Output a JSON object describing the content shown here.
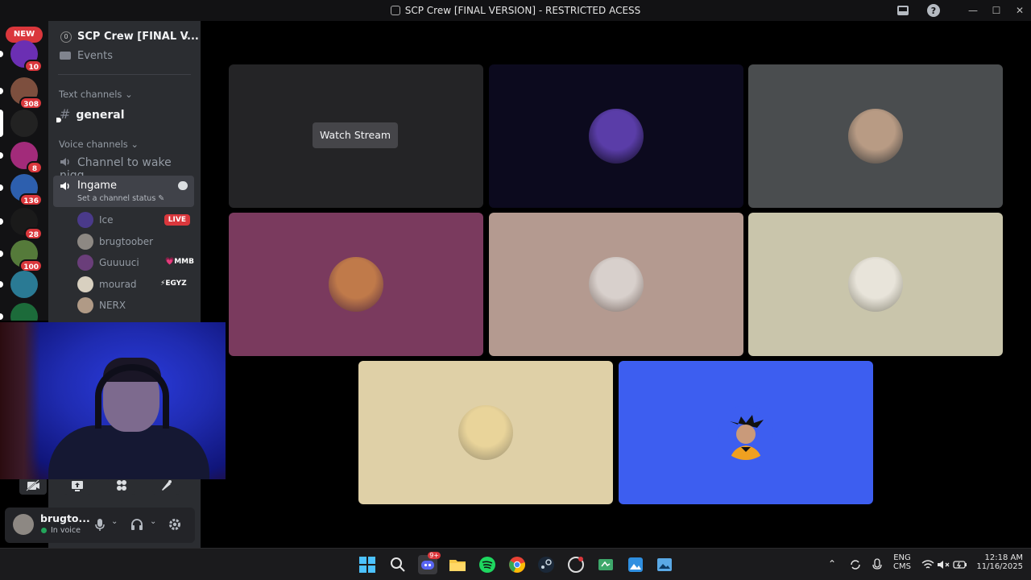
{
  "window": {
    "title": "SCP Crew [FINAL VERSION] - RESTRICTED ACESS",
    "controls": [
      "minimize",
      "maximize",
      "close"
    ]
  },
  "rail": {
    "new_badge": "NEW",
    "servers": [
      {
        "icon": "crown-server-icon",
        "badge": "10",
        "color": "#6b2fb3"
      },
      {
        "icon": "avatar-server-icon",
        "badge": "308",
        "color": "#7d4f3e"
      },
      {
        "icon": "scp-server-icon",
        "badge": "",
        "color": "#222222"
      },
      {
        "icon": "pink-skull-server-icon",
        "badge": "8",
        "color": "#a22b7a"
      },
      {
        "icon": "blue-server-icon",
        "badge": "136",
        "color": "#2d5fae"
      },
      {
        "icon": "m-logo-server-icon",
        "badge": "28",
        "color": "#1a1a1a"
      },
      {
        "icon": "green-server-icon",
        "badge": "100",
        "color": "#557a3a"
      },
      {
        "icon": "dolphin-server-icon",
        "badge": "",
        "color": "#2a7a94"
      },
      {
        "icon": "la-server-icon",
        "badge": "",
        "color": "#1c6b3a"
      }
    ]
  },
  "sidebar": {
    "server_name": "SCP Crew [FINAL V...",
    "events_label": "Events",
    "text_category": "Text channels",
    "text_channel": "general",
    "voice_category": "Voice channels",
    "voice_channel_1": "Channel to wake nigg...",
    "active_voice": {
      "name": "Ingame",
      "status_placeholder": "Set a channel status"
    },
    "members": [
      {
        "name": "Ice",
        "tag": "",
        "live": "LIVE",
        "color": "#4a3a8a"
      },
      {
        "name": "brugtoober",
        "tag": "",
        "live": "",
        "color": "#8d8883"
      },
      {
        "name": "Guuuuci",
        "tag": "💗MMB",
        "live": "",
        "color": "#6a3e7a"
      },
      {
        "name": "mourad",
        "tag": "⚡EGYZ",
        "live": "",
        "color": "#d8d0c0"
      },
      {
        "name": "NERX",
        "tag": "",
        "live": "",
        "color": "#b09a86"
      }
    ]
  },
  "user_panel": {
    "name": "brugto...",
    "status": "In voice"
  },
  "stage": {
    "watch_stream": "Watch Stream",
    "tiles": [
      {
        "bg": "#242426",
        "kind": "stream"
      },
      {
        "bg": "#0c0a1e",
        "kind": "avatar",
        "avatar_color": "#5a3da8"
      },
      {
        "bg": "#4a4d4f",
        "kind": "avatar",
        "avatar_color": "#b89b84"
      },
      {
        "bg": "#7a3a5e",
        "kind": "avatar",
        "avatar_color": "#c07a4a"
      },
      {
        "bg": "#b49a90",
        "kind": "avatar",
        "avatar_color": "#d8d0cc"
      },
      {
        "bg": "#c9c5ab",
        "kind": "avatar",
        "avatar_color": "#e8e4da"
      },
      {
        "bg": "#dfd0a7",
        "kind": "avatar",
        "avatar_color": "#e9d49a"
      },
      {
        "bg": "#3d5ef0",
        "kind": "avatar",
        "avatar_color": "#3d5ef0"
      }
    ]
  },
  "taskbar": {
    "discord_badge": "9+",
    "lang_1": "ENG",
    "lang_2": "CMS",
    "time": "12:18 AM",
    "date": "11/16/2025"
  }
}
